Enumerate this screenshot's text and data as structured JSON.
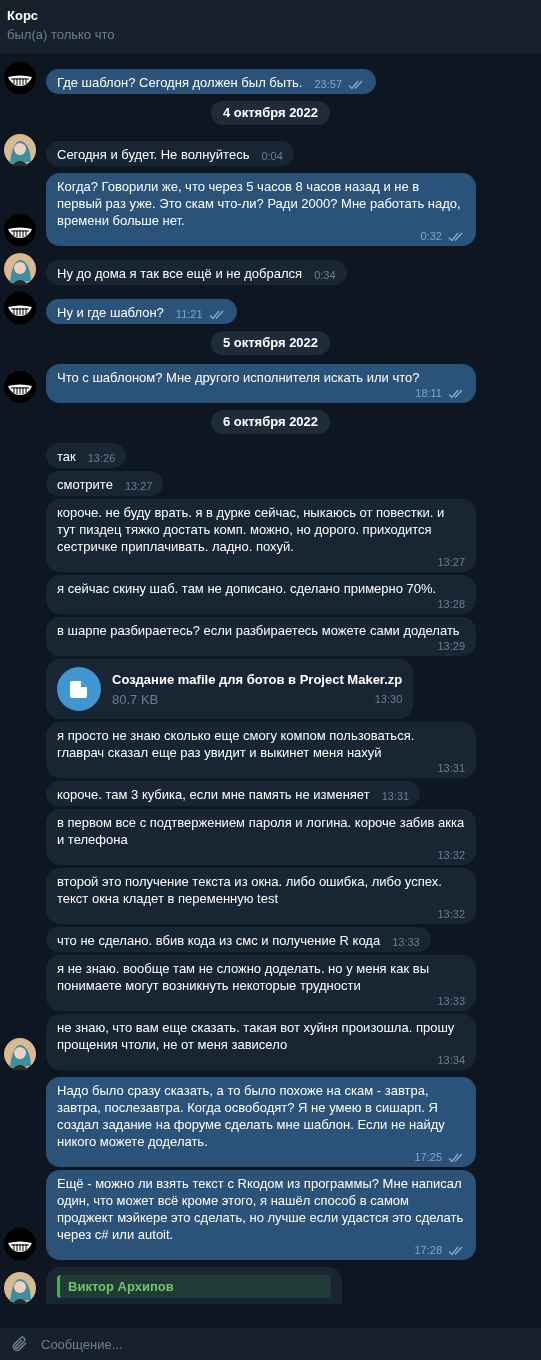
{
  "header": {
    "title": "Корс",
    "status": "был(а) только что"
  },
  "messages": [
    {
      "kind": "text",
      "outgoing": true,
      "text": "Где шаблон? Сегодня должен был быть.",
      "time": "23:57",
      "read": true
    },
    {
      "kind": "date",
      "text": "4 октября 2022"
    },
    {
      "kind": "text",
      "outgoing": false,
      "text": "Сегодня и будет. Не волнуйтесь",
      "time": "0:04"
    },
    {
      "kind": "text",
      "outgoing": true,
      "text": "Когда? Говорили же, что через 5 часов 8 часов назад и не в первый раз уже. Это скам что-ли? Ради 2000? Мне работать надо, времени больше нет.",
      "time": "0:32",
      "read": true
    },
    {
      "kind": "text",
      "outgoing": false,
      "text": "Ну до дома я так все ещё и не добрался",
      "time": "0:34"
    },
    {
      "kind": "text",
      "outgoing": true,
      "text": "Ну и где шаблон?",
      "time": "11:21",
      "read": true
    },
    {
      "kind": "date",
      "text": "5 октября 2022"
    },
    {
      "kind": "text",
      "outgoing": true,
      "text": "Что с шаблоном? Мне другого исполнителя искать или что?",
      "time": "18:11",
      "read": true
    },
    {
      "kind": "date",
      "text": "6 октября 2022"
    },
    {
      "kind": "text",
      "outgoing": false,
      "text": "так",
      "time": "13:26"
    },
    {
      "kind": "text",
      "outgoing": false,
      "text": "смотрите",
      "time": "13:27"
    },
    {
      "kind": "text",
      "outgoing": false,
      "text": "короче. не буду врать. я в дурке сейчас, ныкаюсь от повестки. и тут пиздец тяжко достать комп. можно, но дорого. приходится сестричке приплачивать. ладно. похуй.",
      "time": "13:27"
    },
    {
      "kind": "text",
      "outgoing": false,
      "text": "я сейчас скину шаб. там не дописано. сделано примерно 70%.",
      "time": "13:28"
    },
    {
      "kind": "text",
      "outgoing": false,
      "text": "в шарпе разбираетесь? если разбираетесь можете сами доделать",
      "time": "13:29"
    },
    {
      "kind": "file",
      "outgoing": false,
      "name": "Создание mafile для ботов в Project Maker.zp",
      "size": "80.7 KB",
      "time": "13:30"
    },
    {
      "kind": "text",
      "outgoing": false,
      "text": "я просто не знаю сколько еще смогу компом пользоваться. главрач сказал еще раз увидит и выкинет меня нахуй",
      "time": "13:31"
    },
    {
      "kind": "text",
      "outgoing": false,
      "text": "короче. там 3 кубика, если мне память не изменяет",
      "time": "13:31"
    },
    {
      "kind": "text",
      "outgoing": false,
      "text": "в первом все с подтвержением пароля и логина. короче забив акка и телефона",
      "time": "13:32"
    },
    {
      "kind": "text",
      "outgoing": false,
      "text": "второй это получение текста из окна. либо ошибка, либо успех. текст окна кладет в переменную test",
      "time": "13:32"
    },
    {
      "kind": "text",
      "outgoing": false,
      "text": "что не сделано. вбив кода из смс и получение R кода",
      "time": "13:33"
    },
    {
      "kind": "text",
      "outgoing": false,
      "text": "я не знаю. вообще там не сложно доделать. но у меня как вы понимаете могут возникнуть некоторые трудности",
      "time": "13:33"
    },
    {
      "kind": "text",
      "outgoing": false,
      "text": "не знаю, что вам еще сказать. такая вот хуйня произошла. прошу прощения чтоли, не от меня зависело",
      "time": "13:34"
    },
    {
      "kind": "text",
      "outgoing": true,
      "text": "Надо было сразу сказать, а то было похоже на скам - завтра, завтра, послезавтра. Когда освободят? Я не умею в сишарп. Я создал задание на форуме сделать мне шаблон. Если не найду никого можете доделать.",
      "time": "17:25",
      "read": true
    },
    {
      "kind": "text",
      "outgoing": true,
      "text": "Ещё - можно ли взять текст с Rкодом из программы? Мне написал один, что может всё кроме этого, я нашёл способ в самом проджект мэйкере это сделать, но лучше если удастся это сделать через c# или autoit.",
      "time": "17:28",
      "read": true
    },
    {
      "kind": "reply",
      "outgoing": false,
      "author": "Виктор Архипов"
    }
  ],
  "composer": {
    "placeholder": "Сообщение..."
  }
}
